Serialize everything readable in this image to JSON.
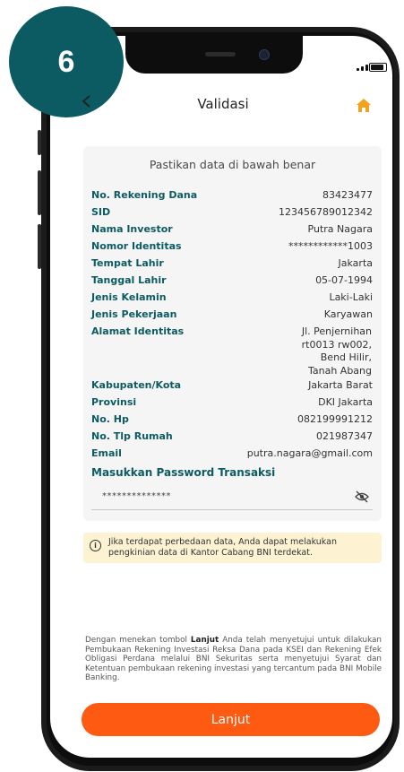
{
  "step": "6",
  "header": {
    "title": "Validasi"
  },
  "card": {
    "title": "Pastikan data di bawah benar",
    "fields": [
      {
        "label": "No. Rekening Dana",
        "value": "83423477"
      },
      {
        "label": "SID",
        "value": "123456789012342"
      },
      {
        "label": "Nama Investor",
        "value": "Putra Nagara"
      },
      {
        "label": "Nomor Identitas",
        "value": "************1003"
      },
      {
        "label": "Tempat Lahir",
        "value": "Jakarta"
      },
      {
        "label": "Tanggal Lahir",
        "value": "05-07-1994"
      },
      {
        "label": "Jenis Kelamin",
        "value": "Laki-Laki"
      },
      {
        "label": "Jenis Pekerjaan",
        "value": "Karyawan"
      }
    ],
    "address": {
      "label": "Alamat Identitas",
      "lines": [
        "Jl. Penjernihan",
        "rt0013 rw002,",
        "Bend Hilir,",
        "Tanah Abang"
      ]
    },
    "fields2": [
      {
        "label": "Kabupaten/Kota",
        "value": "Jakarta Barat"
      },
      {
        "label": "Provinsi",
        "value": "DKI Jakarta"
      },
      {
        "label": "No. Hp",
        "value": "082199991212"
      },
      {
        "label": "No. Tlp Rumah",
        "value": "021987347"
      },
      {
        "label": "Email",
        "value": "putra.nagara@gmail.com"
      }
    ],
    "password": {
      "label": "Masukkan Password Transaksi",
      "value": "**************"
    }
  },
  "info": {
    "text": "Jika terdapat perbedaan data, Anda dapat melakukan pengkinian data di Kantor Cabang BNI terdekat."
  },
  "disclaimer": {
    "before": "Dengan menekan tombol ",
    "bold": "Lanjut",
    "after": " Anda telah menyetujui untuk dilakukan Pembukaan Rekening Investasi Reksa Dana pada KSEI dan Rekening Efek Obligasi Perdana melalui BNI Sekuritas serta menyetujui Syarat dan Ketentuan pembukaan rekening investasi yang tercantum pada BNI Mobile Banking."
  },
  "button": {
    "label": "Lanjut"
  },
  "colors": {
    "accent": "#0c5b63",
    "primary_button": "#ff5a12",
    "info_bg": "#fdf3d2",
    "home_icon": "#f2a21b"
  },
  "icons": [
    "back-arrow-icon",
    "home-icon",
    "eye-slash-icon",
    "info-icon",
    "signal-icon",
    "battery-icon"
  ]
}
